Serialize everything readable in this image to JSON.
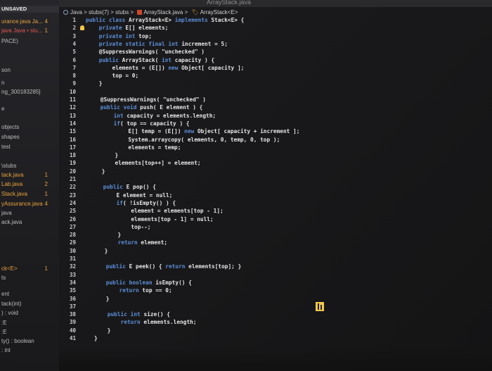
{
  "tab_bar": {
    "title": "ArrayStack.java",
    "subtitle": "...ArrayStack.java"
  },
  "sidebar": {
    "header": "UNSAVED",
    "items": [
      {
        "label": "urance.java Ja...",
        "badge": "4",
        "color": "orange"
      },
      {
        "label": "java  Java • stu...",
        "badge": "1",
        "color": "red"
      },
      {
        "label": "PACE)",
        "badge": "",
        "color": "gray"
      },
      {
        "label": "",
        "badge": "",
        "color": "gray"
      },
      {
        "label": "son",
        "badge": "",
        "color": "gray"
      },
      {
        "label": "n",
        "badge": "",
        "color": "gray"
      },
      {
        "label": "ng_300183285]",
        "badge": "",
        "color": "gray"
      },
      {
        "label": "e",
        "badge": "",
        "color": "gray"
      },
      {
        "label": "objects",
        "badge": "",
        "color": "gray"
      },
      {
        "label": "shapes",
        "badge": "",
        "color": "gray"
      },
      {
        "label": "test",
        "badge": "",
        "color": "gray"
      },
      {
        "label": "\\stubs",
        "badge": "",
        "color": "gray"
      },
      {
        "label": "tack.java",
        "badge": "1",
        "color": "orange"
      },
      {
        "label": "Lab.java",
        "badge": "2",
        "color": "orange"
      },
      {
        "label": "Stack.java",
        "badge": "1",
        "color": "orange"
      },
      {
        "label": "yAssurance.java",
        "badge": "4",
        "color": "orange"
      },
      {
        "label": "java",
        "badge": "",
        "color": "gray"
      },
      {
        "label": "ack.java",
        "badge": "",
        "color": "gray"
      },
      {
        "label": "ck<E>",
        "badge": "1",
        "color": "orange"
      },
      {
        "label": "ts",
        "badge": "",
        "color": "gray"
      },
      {
        "label": "ent",
        "badge": "",
        "color": "gray"
      },
      {
        "label": "tack(int)",
        "badge": "",
        "color": "gray"
      },
      {
        "label": ") : void",
        "badge": "",
        "color": "gray"
      },
      {
        "label": ":E",
        "badge": "",
        "color": "gray"
      },
      {
        "label": ":E",
        "badge": "",
        "color": "gray"
      },
      {
        "label": "ty() : boolean",
        "badge": "",
        "color": "gray"
      },
      {
        "label": ": int",
        "badge": "",
        "color": "gray"
      }
    ]
  },
  "breadcrumb": {
    "items": [
      "Java",
      "stubs(7)",
      "stubs",
      "ArrayStack.java",
      "ArrayStack<E>"
    ],
    "separator": ">"
  },
  "gutter": {
    "line_numbers": [
      "1",
      "2",
      "3",
      "4",
      "5",
      "6",
      "7",
      "8",
      "9",
      "10",
      "11",
      "12",
      "13",
      "14",
      "15",
      "16",
      "17",
      "18",
      "19",
      "20",
      "21",
      "22",
      "23",
      "24",
      "25",
      "26",
      "27",
      "28",
      "29",
      "30",
      "31",
      "32",
      "33",
      "34",
      "35",
      "36",
      "37",
      "38",
      "39",
      "40",
      "41"
    ]
  },
  "code": {
    "lines": [
      "public class ArrayStack<E> implements Stack<E> {",
      "    private E[] elements;",
      "    private int top;",
      "    private static final int increment = 5;",
      "    @SuppressWarnings( \"unchecked\" )",
      "    public ArrayStack( int capacity ) {",
      "        elements = (E[]) new Object[ capacity ];",
      "        top = 0;",
      "    }",
      "",
      "    @SuppressWarnings( \"unchecked\" )",
      "    public void push( E element ) {",
      "        int capacity = elements.length;",
      "        if( top == capacity ) {",
      "            E[] temp = (E[]) new Object[ capacity + increment ];",
      "            System.arraycopy( elements, 0, temp, 0, top );",
      "            elements = temp;",
      "        }",
      "        elements[top++] = element;",
      "    }",
      "",
      "    public E pop() {",
      "        E element = null;",
      "        if( !isEmpty() ) {",
      "            element = elements[top - 1];",
      "            elements[top - 1] = null;",
      "            top--;",
      "        }",
      "        return element;",
      "    }",
      "",
      "    public E peek() { return elements[top]; }",
      "",
      "    public boolean isEmpty() {",
      "        return top == 0;",
      "    }",
      "",
      "    public int size() {",
      "        return elements.length;",
      "    }",
      "}"
    ]
  },
  "colors": {
    "keyword": "#5b8fd6",
    "text": "#e6e6e6",
    "badge": "#e8a23c",
    "error": "#e3574f",
    "background": "#18181a"
  },
  "icons": {
    "bulb": "lightbulb-icon",
    "cursor": "mouse-cursor-icon"
  }
}
